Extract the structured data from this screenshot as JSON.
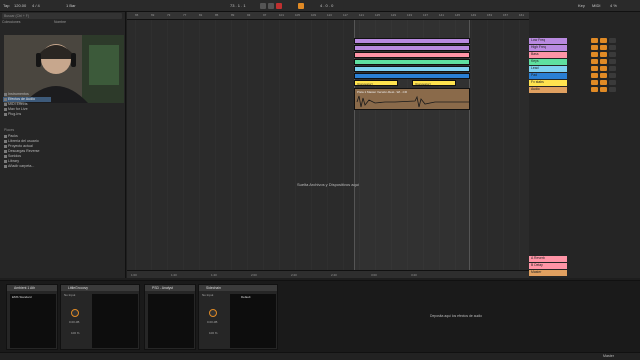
{
  "transport": {
    "tap": "Tap",
    "tempo": "120.00",
    "signature": "4 / 4",
    "metro": "1 Bar",
    "position": "73 . 1 . 1",
    "loop_end": "4 . 0 . 0",
    "key": "Key",
    "midi": "MIDI",
    "cpu": "4 %"
  },
  "browser": {
    "search_placeholder": "Buscar (Ctrl + F)",
    "col_collections": "Colecciones",
    "col_name": "Nombre",
    "categories": [
      {
        "label": "Instrumentos"
      },
      {
        "label": "Efectos de Audio"
      },
      {
        "label": "MIDI Effects"
      },
      {
        "label": "Max for Live"
      },
      {
        "label": "Plug-Ins"
      }
    ],
    "places_title": "Places",
    "places": [
      {
        "label": "Packs"
      },
      {
        "label": "Librería del usuario"
      },
      {
        "label": "Proyecto actual"
      },
      {
        "label": "Descargas Reverse"
      },
      {
        "label": "Sonidos"
      },
      {
        "label": "Library"
      },
      {
        "label": "Añadir carpeta..."
      }
    ]
  },
  "arrangement": {
    "ruler": [
      "65",
      "69",
      "73",
      "77",
      "81",
      "85",
      "89",
      "93",
      "97",
      "101",
      "105",
      "109",
      "113",
      "117",
      "121",
      "125",
      "129",
      "133",
      "137",
      "141",
      "145",
      "149",
      "153",
      "157",
      "161"
    ],
    "drop_text": "Suelta Archivos y Dispositivos aquí",
    "clips": [
      {
        "label": "",
        "color": "#b98ae0"
      },
      {
        "label": "",
        "color": "#b98ae0"
      },
      {
        "label": "",
        "color": "#ff94a6"
      },
      {
        "label": "",
        "color": "#5fe0a0"
      },
      {
        "label": "",
        "color": "#7fd0f0"
      },
      {
        "label": "",
        "color": "#2a7fd4"
      },
      {
        "label": "[Congestor]",
        "color": "#ffe34f"
      }
    ],
    "audio_clip_label": "Pista 1 Master Versión-Rest...Wi...CR",
    "timebar": [
      "1:00",
      "1:20",
      "1:40",
      "2:00",
      "2:20",
      "2:40",
      "3:00",
      "3:20"
    ]
  },
  "mixer": {
    "tracks": [
      {
        "name": "Low Freq",
        "color": "#b98ae0"
      },
      {
        "name": "High Freq",
        "color": "#b98ae0"
      },
      {
        "name": "Bass",
        "color": "#ff94a6"
      },
      {
        "name": "Keys",
        "color": "#5fe0a0"
      },
      {
        "name": "Lead",
        "color": "#7fd0f0"
      },
      {
        "name": "Pad",
        "color": "#2a7fd4"
      },
      {
        "name": "Fx stabs",
        "color": "#ffe34f"
      },
      {
        "name": "Audio",
        "color": "#e0a060"
      }
    ],
    "returns": [
      {
        "name": "A Reverb",
        "color": "#ff94a6"
      },
      {
        "name": "B Delay",
        "color": "#ff94a6"
      }
    ],
    "master": "Master",
    "ext_in": "Ext. In",
    "master_out": "Master"
  },
  "devices": {
    "chains": [
      {
        "title": "Ambient 1 Ath",
        "preset": "EMS Standard",
        "input": "No Input",
        "gain": "0.00 dB",
        "mix": "100 %"
      },
      {
        "title": "LittleGrooovy",
        "preset": "",
        "input": "No Input",
        "gain": "0.00 dB",
        "mix": "100 %"
      },
      {
        "title": "PSD - Analyst",
        "preset": "",
        "input": "",
        "gain": "",
        "mix": ""
      },
      {
        "title": "Sidechain",
        "preset": "Default",
        "input": "No Input",
        "gain": "0.00 dB",
        "mix": "100 %"
      }
    ],
    "drop_effects": "Deposita aquí los efectos de audio"
  },
  "status": {
    "right": "Master"
  }
}
